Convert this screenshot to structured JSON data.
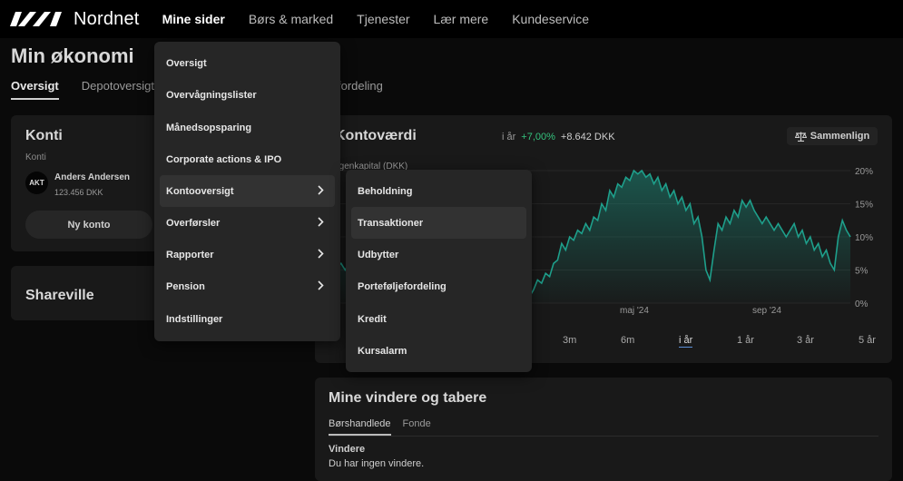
{
  "brand": {
    "name": "Nordnet"
  },
  "nav": {
    "items": [
      {
        "label": "Mine sider",
        "active": true
      },
      {
        "label": "Børs & marked"
      },
      {
        "label": "Tjenester"
      },
      {
        "label": "Lær mere"
      },
      {
        "label": "Kundeservice"
      }
    ]
  },
  "page": {
    "title": "Min økonomi",
    "tabs": [
      {
        "label": "Oversigt",
        "active": true
      },
      {
        "label": "Depotoversigt"
      }
    ],
    "partial_tab": "fordeling"
  },
  "konti": {
    "title": "Konti",
    "subtitle": "Konti",
    "avatar": "AKT",
    "account_name": "Anders Andersen",
    "account_balance": "123.456 DKK",
    "new_account_label": "Ny konto"
  },
  "shareville": {
    "title": "Shareville"
  },
  "kontovaerdi": {
    "title": "Kontoværdi",
    "period": "i år",
    "change_pct": "+7,00%",
    "change_amt": "+8.642 DKK",
    "compare_label": "Sammenlign",
    "equity_label": "Egenkapital (DKK)",
    "y_ticks": [
      "20%",
      "15%",
      "10%",
      "5%",
      "0%"
    ],
    "x_ticks": [
      "maj '24",
      "sep '24"
    ],
    "ranges": [
      "3m",
      "6m",
      "i år",
      "1 år",
      "3 år",
      "5 år"
    ],
    "active_range": "i år"
  },
  "vindere": {
    "title": "Mine vindere og tabere",
    "tabs": [
      "Børshandlede",
      "Fonde"
    ],
    "heading": "Vindere",
    "message": "Du har ingen vindere."
  },
  "menu_main": {
    "items": [
      {
        "label": "Oversigt"
      },
      {
        "label": "Overvågningslister"
      },
      {
        "label": "Månedsopsparing"
      },
      {
        "label": "Corporate actions & IPO"
      },
      {
        "label": "Kontooversigt",
        "has_sub": true,
        "highlight": true
      },
      {
        "label": "Overførsler",
        "has_sub": true
      },
      {
        "label": "Rapporter",
        "has_sub": true
      },
      {
        "label": "Pension",
        "has_sub": true
      },
      {
        "label": "Indstillinger"
      }
    ]
  },
  "menu_sub": {
    "items": [
      {
        "label": "Beholdning"
      },
      {
        "label": "Transaktioner",
        "highlight": true
      },
      {
        "label": "Udbytter"
      },
      {
        "label": "Porteføljefordeling"
      },
      {
        "label": "Kredit"
      },
      {
        "label": "Kursalarm"
      }
    ]
  },
  "colors": {
    "accent_green": "#34c27d",
    "chart_line": "#1e9f8b",
    "menu_bg": "#262626"
  },
  "chart_data": {
    "type": "area",
    "title": "Kontoværdi",
    "ylabel": "",
    "xlabel": "",
    "ylim": [
      0,
      20
    ],
    "x_ticks": [
      "maj '24",
      "sep '24"
    ],
    "series": [
      {
        "values": [
          6,
          5.5,
          6,
          5,
          6,
          5.5,
          6,
          7,
          6.5,
          8,
          7.5,
          9,
          8.5,
          10,
          9,
          9.5,
          10.5,
          9.8,
          10.5,
          10,
          11,
          10.2,
          11,
          10.8,
          10.2,
          11,
          10.4,
          11.2,
          10.8,
          11.5,
          11,
          11.6,
          11.2,
          11.8,
          11.4,
          12,
          11.6,
          11.2,
          10,
          9.5,
          8,
          7,
          6,
          5,
          3,
          1.5,
          0.5,
          1,
          2,
          1,
          2,
          3.5,
          3,
          4.5,
          4,
          6,
          6.5,
          9,
          8,
          10,
          9.5,
          11,
          10.5,
          12,
          11,
          13,
          12.5,
          15,
          14,
          17,
          16,
          18,
          17.5,
          19,
          18.5,
          20,
          19.5,
          20,
          19,
          19.5,
          18,
          19,
          17,
          18,
          16,
          17,
          15,
          16,
          14,
          15,
          12,
          13,
          10,
          5,
          3.5,
          8,
          12,
          11,
          13,
          12,
          14,
          13,
          15.5,
          14.5,
          15.5,
          14,
          13,
          12,
          13,
          12,
          11,
          12,
          11,
          10,
          11,
          12,
          10,
          11,
          9,
          10,
          8,
          9,
          7,
          8,
          6,
          5,
          10,
          12.5,
          11,
          10
        ]
      }
    ]
  }
}
